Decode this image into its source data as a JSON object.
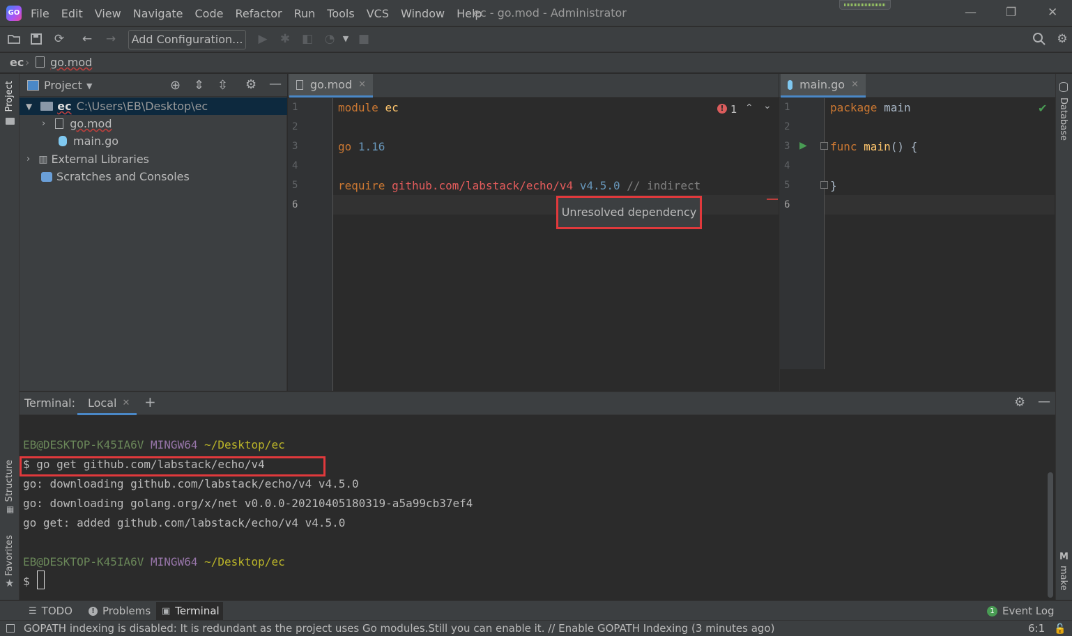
{
  "app": {
    "title": "ec - go.mod - Administrator",
    "menu": [
      "File",
      "Edit",
      "View",
      "Navigate",
      "Code",
      "Refactor",
      "Run",
      "Tools",
      "VCS",
      "Window",
      "Help"
    ]
  },
  "toolbar": {
    "add_config_label": "Add Configuration..."
  },
  "breadcrumb": {
    "root": "ec",
    "file": "go.mod"
  },
  "left_strip": {
    "project_label": "Project",
    "structure_label": "Structure",
    "favorites_label": "Favorites"
  },
  "right_strip": {
    "database_label": "Database",
    "make_label": "make"
  },
  "project_panel": {
    "title": "Project",
    "tree": {
      "root_name": "ec",
      "root_path": "C:\\Users\\EB\\Desktop\\ec",
      "gomod": "go.mod",
      "maingo": "main.go",
      "ext_libs": "External Libraries",
      "scratches": "Scratches and Consoles"
    }
  },
  "editor_left": {
    "tab": "go.mod",
    "error_count": "1",
    "lines": [
      "1",
      "2",
      "3",
      "4",
      "5",
      "6"
    ],
    "code": {
      "l1_kw": "module",
      "l1_name": "ec",
      "l3_kw": "go",
      "l3_ver": "1.16",
      "l5_kw": "require",
      "l5_path": "github.com/labstack/echo/v4",
      "l5_ver": "v4.5.0",
      "l5_cmt": "// indirect"
    },
    "tooltip": "Unresolved dependency"
  },
  "editor_right": {
    "tab": "main.go",
    "lines": [
      "1",
      "2",
      "3",
      "4",
      "5",
      "6"
    ],
    "code": {
      "l1_kw": "package",
      "l1_name": "main",
      "l3_kw": "func",
      "l3_fn": "main",
      "l3_rest": "() {",
      "l5": "}"
    }
  },
  "terminal": {
    "label": "Terminal:",
    "tab": "Local",
    "lines": {
      "prompt1_user": "EB@DESKTOP-K45IA6V",
      "prompt1_env": "MINGW64",
      "prompt1_path": "~/Desktop/ec",
      "cmd": "$ go get github.com/labstack/echo/v4",
      "out1": "go: downloading github.com/labstack/echo/v4 v4.5.0",
      "out2": "go: downloading golang.org/x/net v0.0.0-20210405180319-a5a99cb37ef4",
      "out3": "go get: added github.com/labstack/echo/v4 v4.5.0",
      "prompt2_user": "EB@DESKTOP-K45IA6V",
      "prompt2_env": "MINGW64",
      "prompt2_path": "~/Desktop/ec",
      "dollar": "$"
    }
  },
  "bottom_tabs": {
    "todo": "TODO",
    "problems": "Problems",
    "terminal": "Terminal",
    "event_log_count": "1",
    "event_log": "Event Log"
  },
  "status": {
    "message": "GOPATH indexing is disabled: It is redundant as the project uses Go modules.Still you can enable it. // Enable GOPATH Indexing (3 minutes ago)",
    "position": "6:1"
  }
}
